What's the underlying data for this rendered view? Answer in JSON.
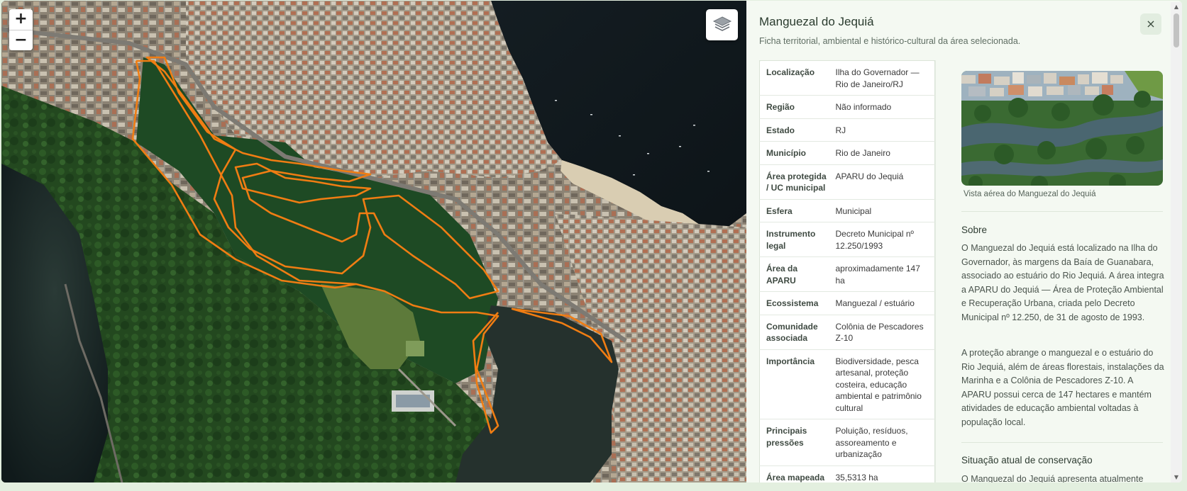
{
  "map": {
    "zoom_in_label": "+",
    "zoom_out_label": "−",
    "layers_icon": "layers-icon",
    "boundary_color": "#f07d13"
  },
  "panel": {
    "title": "Manguezal do Jequiá",
    "subtitle": "Ficha territorial, ambiental e histórico-cultural da área selecionada.",
    "close_label": "×",
    "info_rows": [
      {
        "key": "Localização",
        "value": "Ilha do Governador — Rio de Janeiro/RJ"
      },
      {
        "key": "Região",
        "value": "Não informado"
      },
      {
        "key": "Estado",
        "value": "RJ"
      },
      {
        "key": "Município",
        "value": "Rio de Janeiro"
      },
      {
        "key": "Área protegida / UC municipal",
        "value": "APARU do Jequiá"
      },
      {
        "key": "Esfera",
        "value": "Municipal"
      },
      {
        "key": "Instrumento legal",
        "value": "Decreto Municipal nº 12.250/1993"
      },
      {
        "key": "Área da APARU",
        "value": "aproximadamente 147 ha"
      },
      {
        "key": "Ecossistema",
        "value": "Manguezal / estuário"
      },
      {
        "key": "Comunidade associada",
        "value": "Colônia de Pescadores Z-10"
      },
      {
        "key": "Importância",
        "value": "Biodiversidade, pesca artesanal, proteção costeira, educação ambiental e patrimônio cultural"
      },
      {
        "key": "Principais pressões",
        "value": "Poluição, resíduos, assoreamento e urbanização"
      },
      {
        "key": "Área mapeada",
        "value": "35,5313 ha"
      }
    ],
    "photo_caption": "Vista aérea do Manguezal do Jequiá",
    "about": {
      "title": "Sobre",
      "paragraph_1": "O Manguezal do Jequiá está localizado na Ilha do Governador, às margens da Baía de Guanabara, associado ao estuário do Rio Jequiá. A área integra a APARU do Jequiá — Área de Proteção Ambiental e Recuperação Urbana, criada pelo Decreto Municipal nº 12.250, de 31 de agosto de 1993.",
      "paragraph_2": "A proteção abrange o manguezal e o estuário do Rio Jequiá, além de áreas florestais, instalações da Marinha e a Colônia de Pescadores Z-10. A APARU possui cerca de 147 hectares e mantém atividades de educação ambiental voltadas à população local."
    },
    "conservation": {
      "title": "Situação atual de conservação",
      "paragraph_1": "O Manguezal do Jequiá apresenta atualmente"
    }
  }
}
